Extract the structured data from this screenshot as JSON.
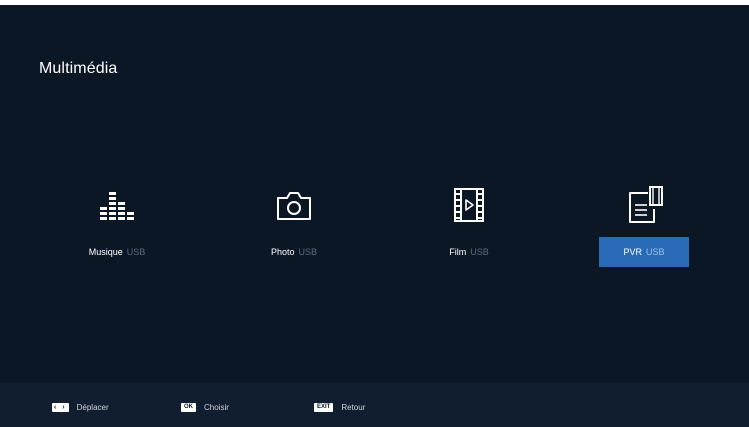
{
  "page": {
    "title": "Multimédia"
  },
  "items": [
    {
      "label": "Musique",
      "source": "USB",
      "icon": "equalizer-icon",
      "selected": false
    },
    {
      "label": "Photo",
      "source": "USB",
      "icon": "camera-icon",
      "selected": false
    },
    {
      "label": "Film",
      "source": "USB",
      "icon": "film-icon",
      "selected": false
    },
    {
      "label": "PVR",
      "source": "USB",
      "icon": "recording-icon",
      "selected": true
    }
  ],
  "footer": {
    "hints": [
      {
        "key": "‹ ›",
        "label": "Déplacer"
      },
      {
        "key": "OK",
        "label": "Choisir"
      },
      {
        "key": "EXIT",
        "label": "Retour"
      }
    ]
  },
  "colors": {
    "background": "#0c1726",
    "footer": "#111e30",
    "selected": "#2a6bb8",
    "text": "#ffffff",
    "muted": "#5d6b7c"
  }
}
